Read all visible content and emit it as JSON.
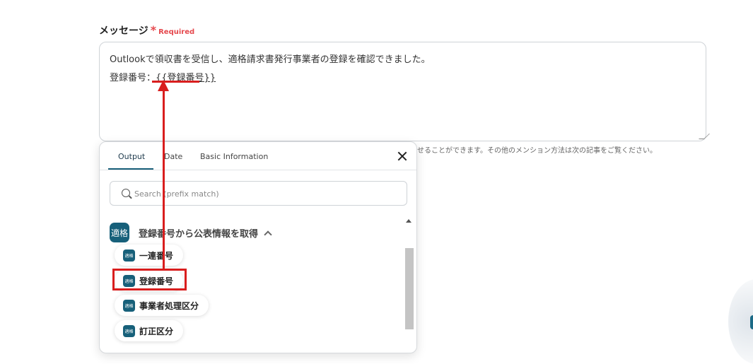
{
  "field": {
    "label": "メッセージ",
    "required_star": "*",
    "required_text": "Required",
    "textarea_line1": "Outlookで領収書を受信し、適格請求書発行事業者の登録を確認できました。",
    "textarea_line2_prefix": "登録番号：",
    "textarea_token": "{{登録番号}}",
    "hint": "せることができます。その他のメンション方法は次の記事をご覧ください。"
  },
  "panel": {
    "tabs": [
      "Output",
      "Date",
      "Basic Information"
    ],
    "active_tab": "Output",
    "search_placeholder": "Search (prefix match)",
    "group": {
      "badge": "適格",
      "title": "登録番号から公表情報を取得"
    },
    "items": [
      {
        "badge": "適格",
        "label": "一連番号"
      },
      {
        "badge": "適格",
        "label": "登録番号"
      },
      {
        "badge": "適格",
        "label": "事業者処理区分"
      },
      {
        "badge": "適格",
        "label": "訂正区分"
      }
    ]
  },
  "colors": {
    "accent": "#17607a",
    "annotation_red": "#d91e1e",
    "required_red": "#e5484d"
  }
}
